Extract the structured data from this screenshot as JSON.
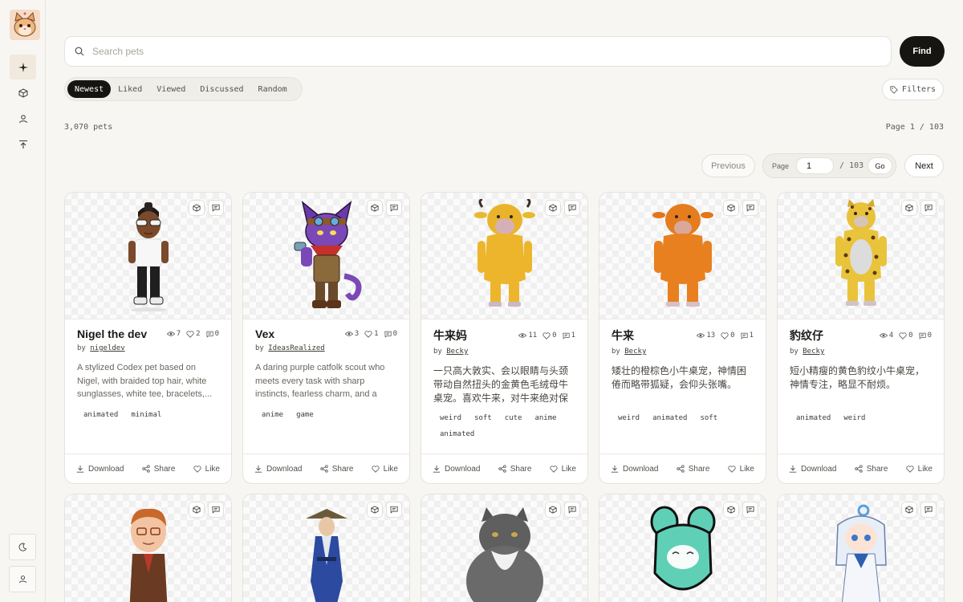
{
  "search": {
    "placeholder": "Search pets",
    "button": "Find"
  },
  "tabs": [
    "Newest",
    "Liked",
    "Viewed",
    "Discussed",
    "Random"
  ],
  "filters_label": "Filters",
  "count": "3,070 pets",
  "page_indicator": "Page 1 / 103",
  "pagination": {
    "previous": "Previous",
    "page_label": "Page",
    "page_value": "1",
    "of_total": "/ 103",
    "go": "Go",
    "next": "Next"
  },
  "card_actions": {
    "download": "Download",
    "share": "Share",
    "like": "Like"
  },
  "author_prefix": "by",
  "cards": [
    {
      "title": "Nigel the dev",
      "views": "7",
      "likes": "2",
      "comments": "0",
      "author": "nigeldev",
      "description": "A stylized Codex pet based on Nigel, with braided top hair, white sunglasses, white tee, bracelets,...",
      "tags": [
        "animated",
        "minimal"
      ]
    },
    {
      "title": "Vex",
      "views": "3",
      "likes": "1",
      "comments": "0",
      "author": "IdeasRealized",
      "description": "A daring purple catfolk scout who meets every task with sharp instincts, fearless charm, and a trus...",
      "tags": [
        "anime",
        "game"
      ]
    },
    {
      "title": "牛来妈",
      "views": "11",
      "likes": "0",
      "comments": "1",
      "author": "Becky",
      "description": "一只高大敦实、会以眼睛与头颈带动自然扭头的金黄色毛绒母牛桌宠。喜欢牛来，对牛来绝对保护欲",
      "tags": [
        "weird",
        "soft",
        "cute",
        "anime",
        "animated"
      ]
    },
    {
      "title": "牛来",
      "views": "13",
      "likes": "0",
      "comments": "1",
      "author": "Becky",
      "description": "矮壮的橙棕色小牛桌宠，神情困倦而略带狐疑，会仰头张嘴。",
      "tags": [
        "weird",
        "animated",
        "soft"
      ]
    },
    {
      "title": "豹纹仔",
      "views": "4",
      "likes": "0",
      "comments": "0",
      "author": "Becky",
      "description": "短小精瘦的黄色豹纹小牛桌宠，神情专注，略显不耐烦。",
      "tags": [
        "animated",
        "weird"
      ]
    }
  ],
  "icons": {
    "sidebar": [
      "sparkle-icon",
      "cube-icon",
      "user-icon",
      "upload-top-icon"
    ],
    "bottom": [
      "moon-icon",
      "user-icon"
    ]
  },
  "colors": {
    "accent_dark": "#171512",
    "active_nav": "#f1e9dd",
    "background": "#f7f6f3"
  }
}
